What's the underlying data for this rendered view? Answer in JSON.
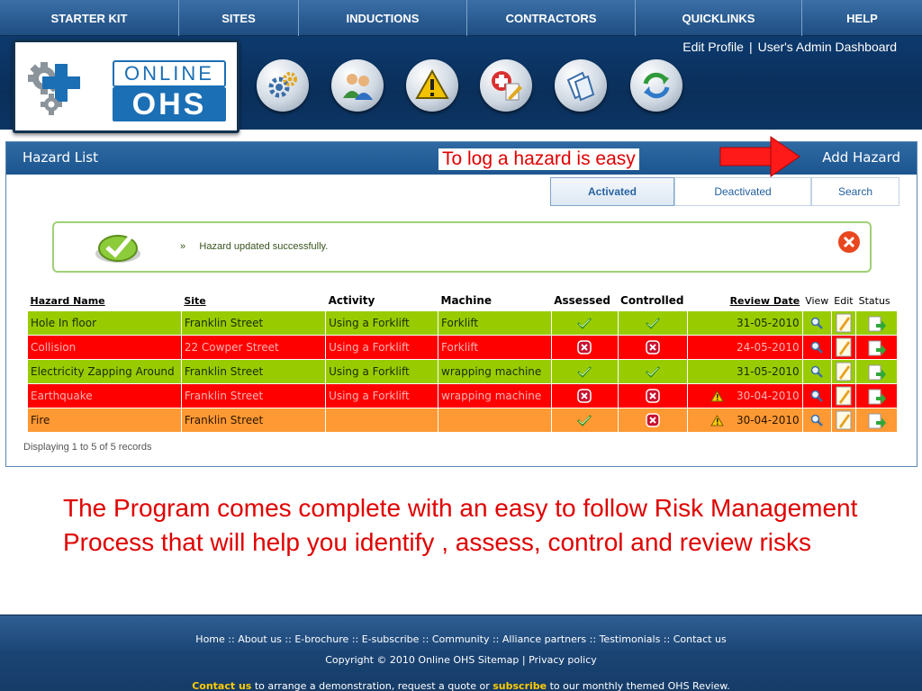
{
  "top_nav": {
    "items": [
      {
        "label": "STARTER KIT"
      },
      {
        "label": "SITES"
      },
      {
        "label": "INDUCTIONS"
      },
      {
        "label": "CONTRACTORS"
      },
      {
        "label": "QUICKLINKS"
      },
      {
        "label": "HELP"
      }
    ]
  },
  "header": {
    "logo_online": "ONLINE",
    "logo_ohs": "OHS",
    "edit_profile": "Edit Profile",
    "separator": "|",
    "admin_dashboard": "User's Admin Dashboard",
    "icons": [
      "gears-icon",
      "users-icon",
      "warning-icon",
      "first-aid-edit-icon",
      "documents-icon",
      "refresh-icon"
    ]
  },
  "panel": {
    "title": "Hazard List",
    "add_hazard": "Add Hazard",
    "callout": "To log a hazard is easy",
    "tabs": [
      {
        "label": "Activated",
        "active": true
      },
      {
        "label": "Deactivated",
        "active": false
      },
      {
        "label": "Search",
        "active": false
      }
    ],
    "message": {
      "bullet": "»",
      "text": "Hazard updated successfully."
    },
    "table": {
      "headers": {
        "hazard_name": "Hazard Name",
        "site": "Site",
        "activity": "Activity",
        "machine": "Machine",
        "assessed": "Assessed",
        "controlled": "Controlled",
        "review_date": "Review Date",
        "view": "View",
        "edit": "Edit",
        "status": "Status"
      },
      "rows": [
        {
          "hazard": "Hole In floor",
          "site": "Franklin Street",
          "activity": "Using a Forklift",
          "machine": "Forklift",
          "assessed": true,
          "controlled": true,
          "warning": false,
          "review_date": "31-05-2010",
          "row_color": "green"
        },
        {
          "hazard": "Collision",
          "site": "22 Cowper Street",
          "activity": "Using a Forklift",
          "machine": "Forklift",
          "assessed": false,
          "controlled": false,
          "warning": false,
          "review_date": "24-05-2010",
          "row_color": "red"
        },
        {
          "hazard": "Electricity Zapping Around",
          "site": "Franklin Street",
          "activity": "Using a Forklift",
          "machine": "wrapping machine",
          "assessed": true,
          "controlled": true,
          "warning": false,
          "review_date": "31-05-2010",
          "row_color": "green"
        },
        {
          "hazard": "Earthquake",
          "site": "Franklin Street",
          "activity": "Using a Forklift",
          "machine": "wrapping machine",
          "assessed": false,
          "controlled": false,
          "warning": true,
          "review_date": "30-04-2010",
          "row_color": "red"
        },
        {
          "hazard": "Fire",
          "site": "Franklin Street",
          "activity": "",
          "machine": "",
          "assessed": true,
          "controlled": false,
          "warning": true,
          "review_date": "30-04-2010",
          "row_color": "orange"
        }
      ]
    },
    "records": "Displaying 1 to 5 of 5 records"
  },
  "blurb": "The Program comes complete with an easy to follow Risk Management  Process that will help you identify , assess, control  and review risks",
  "footer": {
    "links": [
      "Home",
      "About us",
      "E-brochure",
      "E-subscribe",
      "Community",
      "Alliance partners",
      "Testimonials",
      "Contact us"
    ],
    "link_separator": " :: ",
    "copyright": "Copyright © 2010 Online OHS",
    "sitemap": "Sitemap",
    "privacy": "Privacy policy",
    "contact_us": "Contact us",
    "contact_mid": " to arrange a demonstration, request a quote or ",
    "subscribe": "subscribe",
    "contact_end": " to our monthly themed OHS Review."
  },
  "colors": {
    "nav_blue": "#1f4e82",
    "header_navy": "#0a2f5a",
    "row_green": "#99cc00",
    "row_red": "#ff0000",
    "row_orange": "#ff9933",
    "callout_red": "#e00000",
    "footer_highlight": "#ffcc00"
  }
}
